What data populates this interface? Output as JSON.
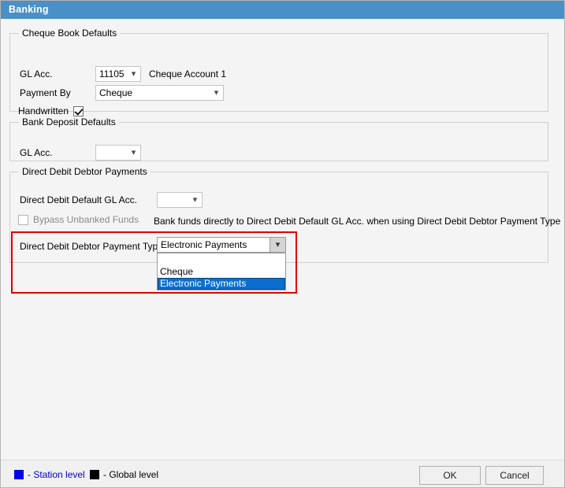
{
  "window": {
    "title": "Banking",
    "titlebar_color": "#4a90c8"
  },
  "groups": {
    "cheque_book": {
      "legend": "Cheque Book Defaults",
      "gl_acc_label": "GL Acc.",
      "gl_acc_value": "11105",
      "gl_acc_description": "Cheque Account 1",
      "payment_by_label": "Payment By",
      "payment_by_value": "Cheque",
      "handwritten_label": "Handwritten",
      "handwritten_checked": true
    },
    "bank_deposit": {
      "legend": "Bank Deposit Defaults",
      "gl_acc_label": "GL Acc.",
      "gl_acc_value": ""
    },
    "direct_debit": {
      "legend": "Direct Debit Debtor Payments",
      "default_gl_acc_label": "Direct Debit Default GL Acc.",
      "default_gl_acc_value": "",
      "bypass_label": "Bypass Unbanked Funds",
      "bypass_checked": false,
      "bypass_note": "Bank funds directly to Direct Debit Default GL Acc. when using Direct Debit Debtor Payment Type",
      "payment_type_label": "Direct Debit Debtor Payment Type",
      "payment_type_value": "Electronic Payments",
      "payment_type_options": [
        "",
        "Cheque",
        "Electronic Payments"
      ],
      "payment_type_selected_index": 2,
      "highlight_color": "#e00000"
    }
  },
  "footer": {
    "legend_station": "- Station level",
    "legend_station_color": "#0000cd",
    "legend_global": "- Global level",
    "legend_global_color": "#000000",
    "ok_label": "OK",
    "cancel_label": "Cancel"
  },
  "icons": {
    "dropdown_arrow": "chevron-down-icon",
    "checkmark": "check-icon"
  }
}
